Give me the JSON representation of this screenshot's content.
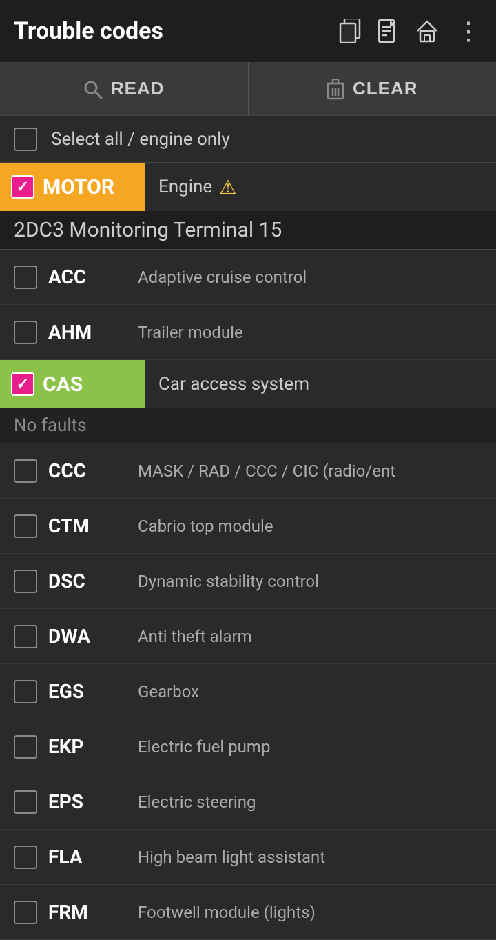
{
  "header": {
    "title": "Trouble codes",
    "icons": [
      "copy",
      "document",
      "home",
      "more"
    ]
  },
  "toolbar": {
    "read_label": "READ",
    "clear_label": "CLEAR"
  },
  "select_all": {
    "label": "Select all / engine only",
    "checked": false
  },
  "motor_module": {
    "tag": "MOTOR",
    "description": "Engine",
    "checked": true,
    "has_warning": true,
    "subheader": "2DC3 Monitoring Terminal 15"
  },
  "module_items_before_cas": [
    {
      "code": "ACC",
      "description": "Adaptive cruise control",
      "checked": false
    },
    {
      "code": "AHM",
      "description": "Trailer module",
      "checked": false
    }
  ],
  "cas_module": {
    "tag": "CAS",
    "description": "Car access system",
    "checked": true,
    "status": "No faults"
  },
  "module_items_after_cas": [
    {
      "code": "CCC",
      "description": "MASK / RAD / CCC / CIC (radio/ent",
      "checked": false
    },
    {
      "code": "CTM",
      "description": "Cabrio top module",
      "checked": false
    },
    {
      "code": "DSC",
      "description": "Dynamic stability control",
      "checked": false
    },
    {
      "code": "DWA",
      "description": "Anti theft alarm",
      "checked": false
    },
    {
      "code": "EGS",
      "description": "Gearbox",
      "checked": false
    },
    {
      "code": "EKP",
      "description": "Electric fuel pump",
      "checked": false
    },
    {
      "code": "EPS",
      "description": "Electric steering",
      "checked": false
    },
    {
      "code": "FLA",
      "description": "High beam light assistant",
      "checked": false
    },
    {
      "code": "FRM",
      "description": "Footwell module (lights)",
      "checked": false
    }
  ]
}
